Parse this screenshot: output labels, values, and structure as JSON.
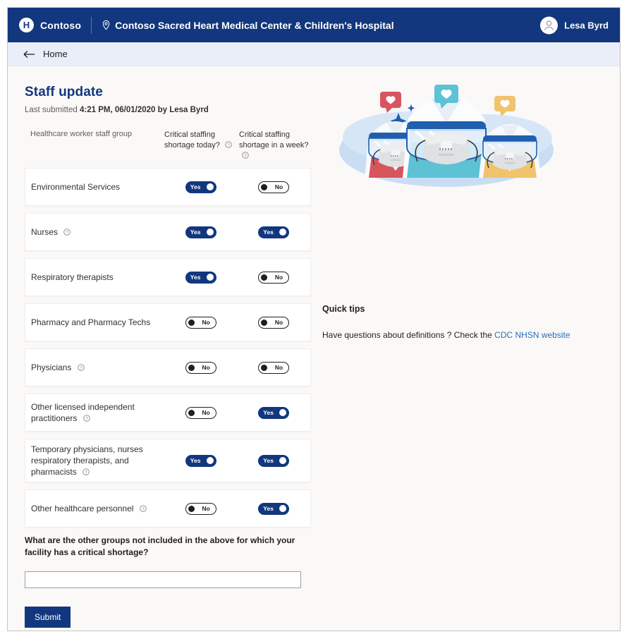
{
  "topbar": {
    "logo_letter": "H",
    "brand_name": "Contoso",
    "facility_name": "Contoso Sacred Heart Medical Center & Children's Hospital",
    "pin_icon": "location-pin-icon",
    "avatar_icon": "user-avatar-icon",
    "user_name": "Lesa Byrd"
  },
  "navbar": {
    "back_icon": "arrow-left-icon",
    "home_label": "Home"
  },
  "page": {
    "title": "Staff update",
    "last_submitted_prefix": "Last submitted",
    "last_submitted_value": "4:21 PM, 06/01/2020 by Lesa Byrd"
  },
  "table": {
    "headers": {
      "group": "Healthcare worker staff group",
      "today": "Critical staffing shortage today?",
      "week": "Critical staffing shortage in a week?"
    },
    "help_icon": "help-circle-icon",
    "rows": [
      {
        "label": "Environmental Services",
        "has_help": false,
        "today": "Yes",
        "week": "No"
      },
      {
        "label": "Nurses",
        "has_help": true,
        "today": "Yes",
        "week": "Yes"
      },
      {
        "label": "Respiratory therapists",
        "has_help": false,
        "today": "Yes",
        "week": "No"
      },
      {
        "label": "Pharmacy and Pharmacy Techs",
        "has_help": false,
        "today": "No",
        "week": "No"
      },
      {
        "label": "Physicians",
        "has_help": true,
        "today": "No",
        "week": "No"
      },
      {
        "label": "Other licensed independent practitioners",
        "has_help": true,
        "today": "No",
        "week": "Yes"
      },
      {
        "label": "Temporary physicians, nurses respiratory therapists, and pharmacists",
        "has_help": true,
        "today": "Yes",
        "week": "Yes"
      },
      {
        "label": "Other healthcare personnel",
        "has_help": true,
        "today": "No",
        "week": "Yes"
      }
    ]
  },
  "form": {
    "other_groups_question": "What are the other groups not included in the above for which your facility has a critical shortage?",
    "other_groups_value": "",
    "other_groups_placeholder": "",
    "submit_label": "Submit"
  },
  "quick_tips": {
    "title": "Quick tips",
    "text_before_link": "Have questions about definitions ? Check the ",
    "link_label": "CDC NHSN website",
    "illustration_name": "healthcare-workers-masks-illustration"
  },
  "colors": {
    "brand_blue": "#12377e",
    "nav_background": "#e9eef8",
    "page_background": "#faf9f8",
    "link_blue": "#2b6fbb"
  }
}
